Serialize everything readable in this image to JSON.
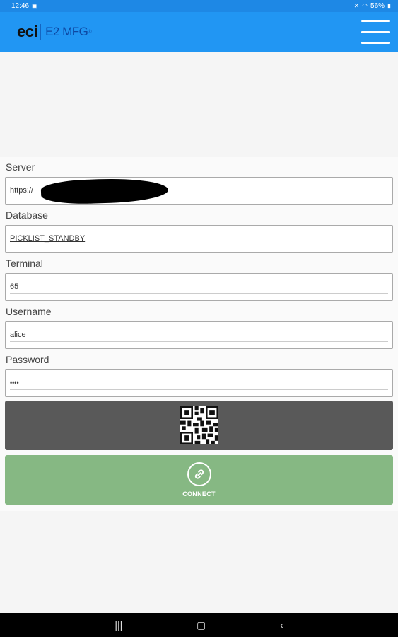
{
  "status_bar": {
    "time": "12:46",
    "battery": "56%"
  },
  "app_bar": {
    "logo_primary": "eci",
    "logo_product": "E2 MFG",
    "logo_tm": "®"
  },
  "form": {
    "server": {
      "label": "Server",
      "value": "https://"
    },
    "database": {
      "label": "Database",
      "value": "PICKLIST_STANDBY"
    },
    "terminal": {
      "label": "Terminal",
      "value": "65"
    },
    "username": {
      "label": "Username",
      "value": "alice"
    },
    "password": {
      "label": "Password",
      "value": "••••"
    }
  },
  "buttons": {
    "connect_label": "CONNECT"
  },
  "colors": {
    "app_bar": "#2196f3",
    "qr_button": "#595959",
    "connect_button": "#86b883"
  }
}
